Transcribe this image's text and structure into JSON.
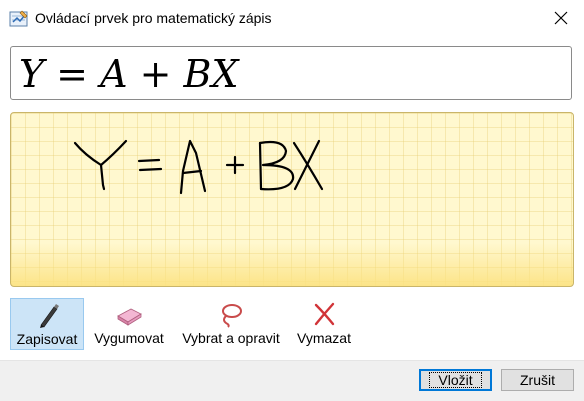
{
  "window": {
    "title": "Ovládací prvek pro matematický zápis",
    "icon": "math-input-icon",
    "close_icon": "close-icon"
  },
  "preview": {
    "expression": [
      "Y",
      " = ",
      "A",
      " + ",
      "B",
      "X"
    ]
  },
  "tools": [
    {
      "label": "Zapisovat",
      "icon": "pen-icon",
      "active": true
    },
    {
      "label": "Vygumovat",
      "icon": "eraser-icon",
      "active": false
    },
    {
      "label": "Vybrat a opravit",
      "icon": "lasso-icon",
      "active": false
    },
    {
      "label": "Vymazat",
      "icon": "clear-icon",
      "active": false
    }
  ],
  "buttons": {
    "insert": "Vložit",
    "cancel": "Zrušit"
  },
  "colors": {
    "ink_background": "#fff8cf",
    "active_tool": "#cce4f7",
    "default_button_border": "#0078d7",
    "clear_icon": "#d13438",
    "lasso_icon": "#c94b4b"
  }
}
